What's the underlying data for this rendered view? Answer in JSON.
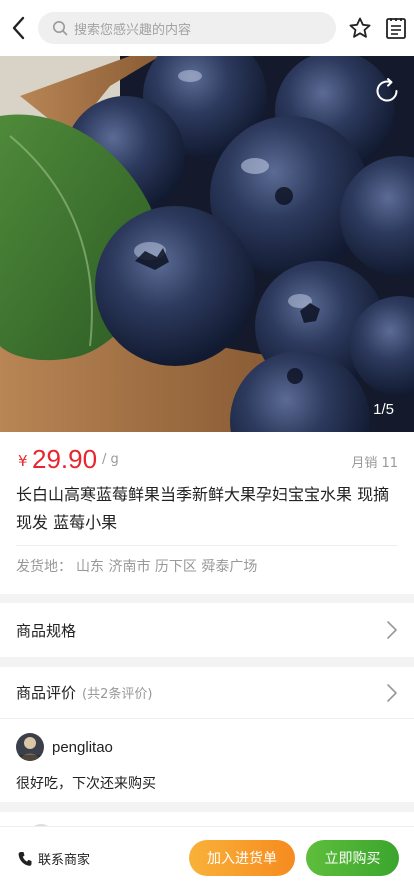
{
  "header": {
    "search_placeholder": "搜索您感兴趣的内容",
    "icons": [
      "back-arrow-icon",
      "search-icon",
      "star-icon",
      "notes-icon"
    ]
  },
  "gallery": {
    "pager": "1/5",
    "share_icon": "share-refresh-icon"
  },
  "product": {
    "currency": "¥",
    "price": "29.90",
    "unit": "/ g",
    "monthly_sales": "月销 11",
    "title": "长白山高寒蓝莓鲜果当季新鲜大果孕妇宝宝水果 现摘现发 蓝莓小果",
    "ship_label": "发货地：",
    "ship_from": "山东 济南市 历下区 舜泰广场",
    "price_color": "#e8262d"
  },
  "spec": {
    "label": "商品规格"
  },
  "reviews": {
    "title": "商品评价",
    "count": "(共2条评价)",
    "items": [
      {
        "user": "penglitao",
        "text": "很好吃，下次还来购买"
      }
    ]
  },
  "bottom_bar": {
    "contact": "联系商家",
    "add_cart": "加入进货单",
    "buy_now": "立即购买",
    "cart_color": "#f7991f",
    "buy_color": "#4caf35"
  }
}
